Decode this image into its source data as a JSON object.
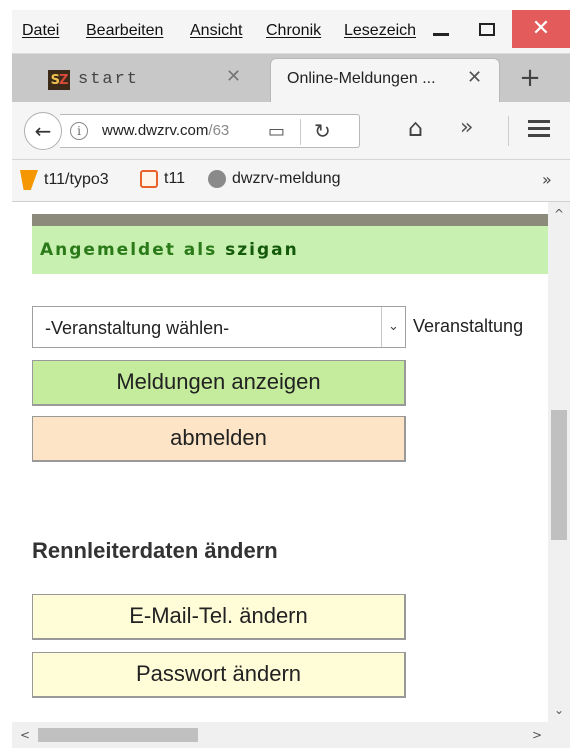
{
  "menubar": {
    "items": [
      "Datei",
      "Bearbeiten",
      "Ansicht",
      "Chronik",
      "Lesezeich"
    ],
    "close_glyph": "✕"
  },
  "tabs": [
    {
      "title": "start",
      "favicon_s": "S",
      "favicon_z": "Z",
      "close_glyph": "✕",
      "active": false
    },
    {
      "title": "Online-Meldungen ...",
      "close_glyph": "✕",
      "active": true
    }
  ],
  "new_tab_glyph": "+",
  "navbar": {
    "back_glyph": "←",
    "info_glyph": "i",
    "url_host": "www.dwzrv.com",
    "url_path": "/63",
    "reader_glyph": "▭",
    "reload_glyph": "↻",
    "home_glyph": "⌂",
    "overflow_glyph": "»"
  },
  "bookmarks": {
    "items": [
      "t11/typo3",
      "t11",
      "dwzrv-meldung"
    ],
    "overflow_glyph": "»"
  },
  "page": {
    "logged_in_prefix": "Angemeldet als ",
    "username": "szigan",
    "select": {
      "value": "-Veranstaltung wählen-",
      "arrow": "⌄",
      "label": "Veranstaltung"
    },
    "show_reports_button": "Meldungen anzeigen",
    "logout_button": "abmelden",
    "section_title": "Rennleiterdaten ändern",
    "email_button": "E-Mail-Tel. ändern",
    "password_button": "Passwort ändern"
  },
  "scrollbars": {
    "up": "^",
    "down": "⌄",
    "left": "<",
    "right": ">"
  },
  "colors": {
    "close_button": "#e35b5b",
    "logged_in_bg": "#c8f0b0",
    "logged_in_text": "#2b7a1a",
    "green_button": "#c4ec9c",
    "orange_button": "#fde4c6",
    "yellow_button": "#fffcd8",
    "header_bar": "#8c8a7a"
  },
  "icons": {
    "back": "back-arrow-icon",
    "info": "info-icon",
    "reader": "reader-view-icon",
    "reload": "reload-icon",
    "home": "home-icon",
    "menu": "hamburger-menu-icon",
    "typo3": "typo3-icon",
    "t11": "t11-icon",
    "globe": "globe-icon"
  }
}
